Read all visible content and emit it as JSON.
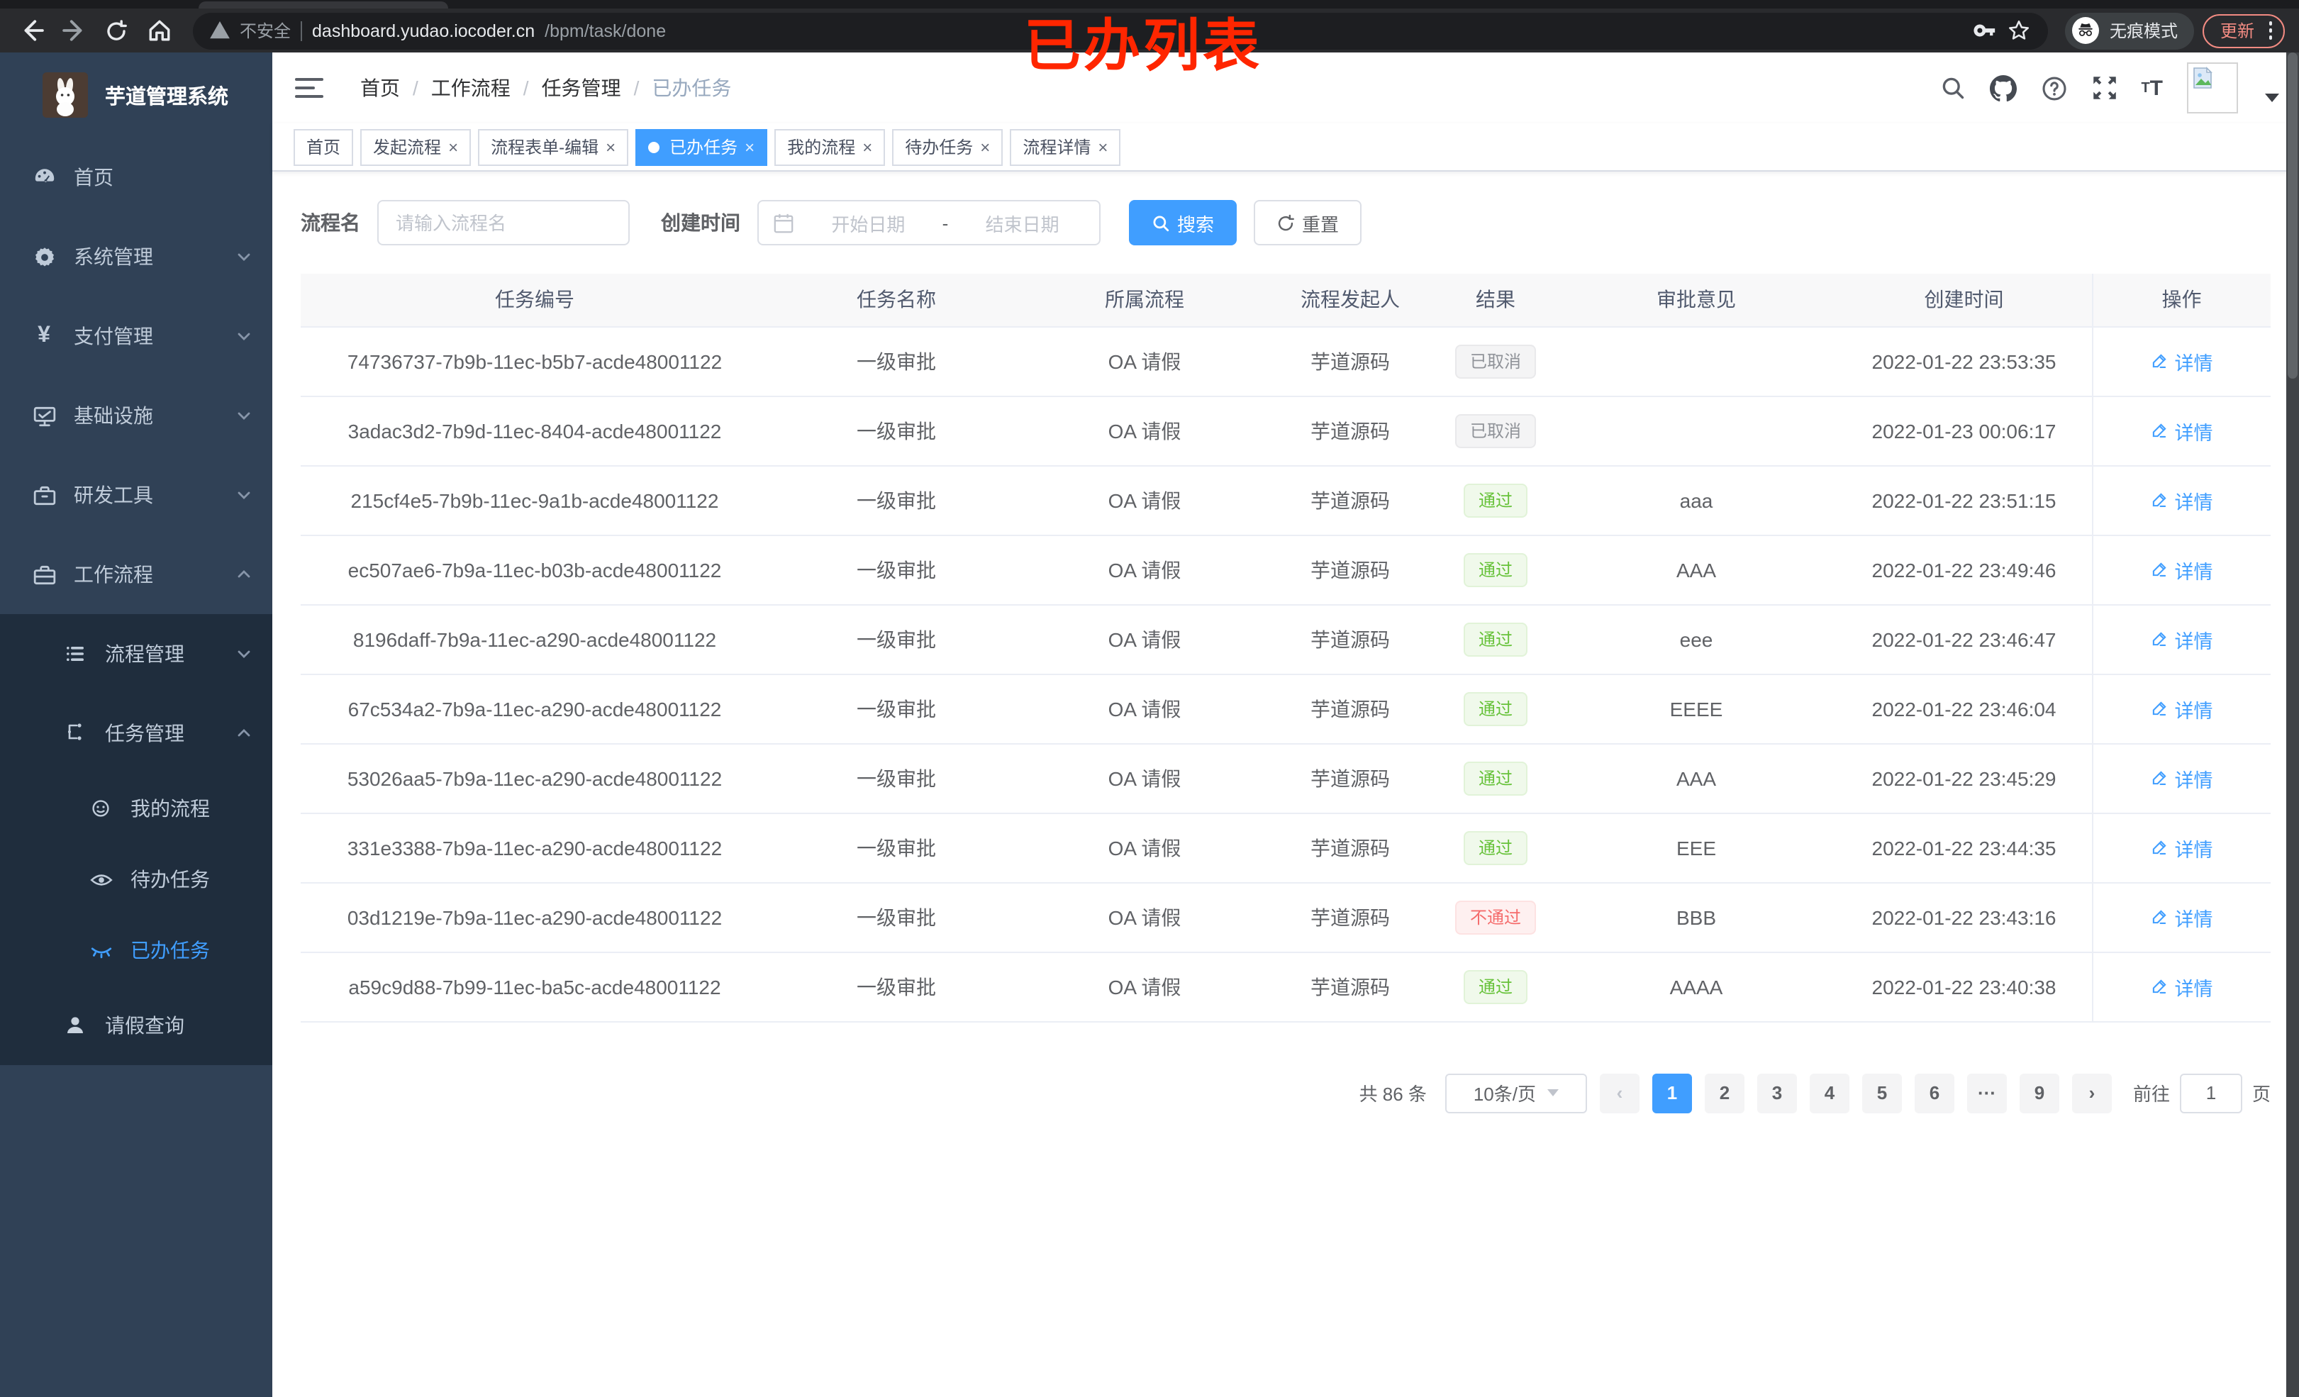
{
  "annotation": {
    "text": "已办列表",
    "color": "#ff2600"
  },
  "browser": {
    "security_label": "不安全",
    "url_host": "dashboard.yudao.iocoder.cn",
    "url_path": "/bpm/task/done",
    "incognito_label": "无痕模式",
    "update_label": "更新"
  },
  "sidebar": {
    "app_title": "芋道管理系统",
    "items": [
      {
        "label": "首页"
      },
      {
        "label": "系统管理"
      },
      {
        "label": "支付管理"
      },
      {
        "label": "基础设施"
      },
      {
        "label": "研发工具"
      },
      {
        "label": "工作流程"
      }
    ],
    "sub_items": [
      {
        "label": "流程管理"
      },
      {
        "label": "任务管理"
      }
    ],
    "task_items": [
      {
        "label": "我的流程"
      },
      {
        "label": "待办任务"
      },
      {
        "label": "已办任务"
      }
    ],
    "leave_label": "请假查询"
  },
  "header": {
    "breadcrumb": [
      "首页",
      "工作流程",
      "任务管理",
      "已办任务"
    ]
  },
  "tabs": [
    {
      "label": "首页",
      "class": "tag"
    },
    {
      "label": "发起流程",
      "class": "tag"
    },
    {
      "label": "流程表单-编辑",
      "class": "tag"
    },
    {
      "label": "已办任务",
      "class": "tag active"
    },
    {
      "label": "我的流程",
      "class": "tag"
    },
    {
      "label": "待办任务",
      "class": "tag"
    },
    {
      "label": "流程详情",
      "class": "tag"
    }
  ],
  "filters": {
    "process_name_label": "流程名",
    "process_name_placeholder": "请输入流程名",
    "create_time_label": "创建时间",
    "date_start_placeholder": "开始日期",
    "date_separator": "-",
    "date_end_placeholder": "结束日期",
    "search_label": "搜索",
    "reset_label": "重置"
  },
  "table": {
    "columns": [
      "任务编号",
      "任务名称",
      "所属流程",
      "流程发起人",
      "结果",
      "审批意见",
      "创建时间",
      "操作"
    ],
    "action_label": "详情",
    "rows": [
      {
        "id": "74736737-7b9b-11ec-b5b7-acde48001122",
        "name": "一级审批",
        "process": "OA 请假",
        "starter": "芋道源码",
        "result": "已取消",
        "result_class": "badge cancel",
        "opinion": "",
        "created": "2022-01-22 23:53:35"
      },
      {
        "id": "3adac3d2-7b9d-11ec-8404-acde48001122",
        "name": "一级审批",
        "process": "OA 请假",
        "starter": "芋道源码",
        "result": "已取消",
        "result_class": "badge cancel",
        "opinion": "",
        "created": "2022-01-23 00:06:17"
      },
      {
        "id": "215cf4e5-7b9b-11ec-9a1b-acde48001122",
        "name": "一级审批",
        "process": "OA 请假",
        "starter": "芋道源码",
        "result": "通过",
        "result_class": "badge pass",
        "opinion": "aaa",
        "created": "2022-01-22 23:51:15"
      },
      {
        "id": "ec507ae6-7b9a-11ec-b03b-acde48001122",
        "name": "一级审批",
        "process": "OA 请假",
        "starter": "芋道源码",
        "result": "通过",
        "result_class": "badge pass",
        "opinion": "AAA",
        "created": "2022-01-22 23:49:46"
      },
      {
        "id": "8196daff-7b9a-11ec-a290-acde48001122",
        "name": "一级审批",
        "process": "OA 请假",
        "starter": "芋道源码",
        "result": "通过",
        "result_class": "badge pass",
        "opinion": "eee",
        "created": "2022-01-22 23:46:47"
      },
      {
        "id": "67c534a2-7b9a-11ec-a290-acde48001122",
        "name": "一级审批",
        "process": "OA 请假",
        "starter": "芋道源码",
        "result": "通过",
        "result_class": "badge pass",
        "opinion": "EEEE",
        "created": "2022-01-22 23:46:04"
      },
      {
        "id": "53026aa5-7b9a-11ec-a290-acde48001122",
        "name": "一级审批",
        "process": "OA 请假",
        "starter": "芋道源码",
        "result": "通过",
        "result_class": "badge pass",
        "opinion": "AAA",
        "created": "2022-01-22 23:45:29"
      },
      {
        "id": "331e3388-7b9a-11ec-a290-acde48001122",
        "name": "一级审批",
        "process": "OA 请假",
        "starter": "芋道源码",
        "result": "通过",
        "result_class": "badge pass",
        "opinion": "EEE",
        "created": "2022-01-22 23:44:35"
      },
      {
        "id": "03d1219e-7b9a-11ec-a290-acde48001122",
        "name": "一级审批",
        "process": "OA 请假",
        "starter": "芋道源码",
        "result": "不通过",
        "result_class": "badge fail",
        "opinion": "BBB",
        "created": "2022-01-22 23:43:16"
      },
      {
        "id": "a59c9d88-7b99-11ec-ba5c-acde48001122",
        "name": "一级审批",
        "process": "OA 请假",
        "starter": "芋道源码",
        "result": "通过",
        "result_class": "badge pass",
        "opinion": "AAAA",
        "created": "2022-01-22 23:40:38"
      }
    ]
  },
  "pagination": {
    "total_text": "共 86 条",
    "page_size": "10条/页",
    "prev_glyph": "‹",
    "next_glyph": "›",
    "pages": [
      {
        "label": "1",
        "class": "page active"
      },
      {
        "label": "2",
        "class": "page"
      },
      {
        "label": "3",
        "class": "page"
      },
      {
        "label": "4",
        "class": "page"
      },
      {
        "label": "5",
        "class": "page"
      },
      {
        "label": "6",
        "class": "page"
      },
      {
        "label": "···",
        "class": "page"
      },
      {
        "label": "9",
        "class": "page"
      }
    ],
    "goto_label": "前往",
    "goto_value": "1",
    "page_unit": "页"
  },
  "colors": {
    "accent": "#409eff",
    "success": "#67c23a",
    "danger": "#f56c6c",
    "info": "#909399",
    "sidebar_bg": "#304156",
    "submenu_bg": "#1f2d3d",
    "annotation_red": "#ff2600",
    "update_salmon": "#f28b82"
  }
}
